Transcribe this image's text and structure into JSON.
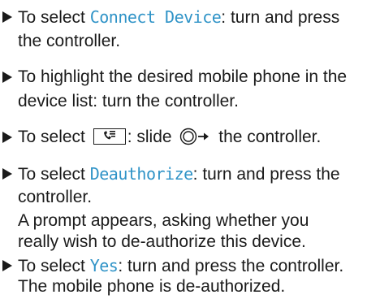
{
  "steps": [
    {
      "lines": [
        {
          "prefix": "To select ",
          "term": "Connect Device",
          "suffix": ": turn and press"
        },
        {
          "text": "the controller."
        }
      ]
    },
    {
      "lines": [
        {
          "text": "To highlight the desired mobile phone in the"
        },
        {
          "text": "device list: turn the controller."
        }
      ]
    },
    {
      "lines": [
        {
          "prefix": "To select ",
          "icon": "phone-menu-icon",
          "middle": ": slide ",
          "icon2": "controller-slide-right-icon",
          "suffix": " the controller."
        }
      ]
    },
    {
      "lines": [
        {
          "prefix": "To select ",
          "term": "Deauthorize",
          "suffix": ": turn and press the"
        },
        {
          "text": "controller."
        },
        {
          "text": "A prompt appears, asking whether you"
        },
        {
          "text": "really wish to de-authorize this device."
        }
      ]
    },
    {
      "lines": [
        {
          "prefix": "To select ",
          "term": "Yes",
          "suffix": ": turn and press the controller."
        },
        {
          "text": "The mobile phone is de-authorized."
        }
      ]
    }
  ],
  "colors": {
    "text": "#1a1a1a",
    "term": "#2f93c7"
  }
}
